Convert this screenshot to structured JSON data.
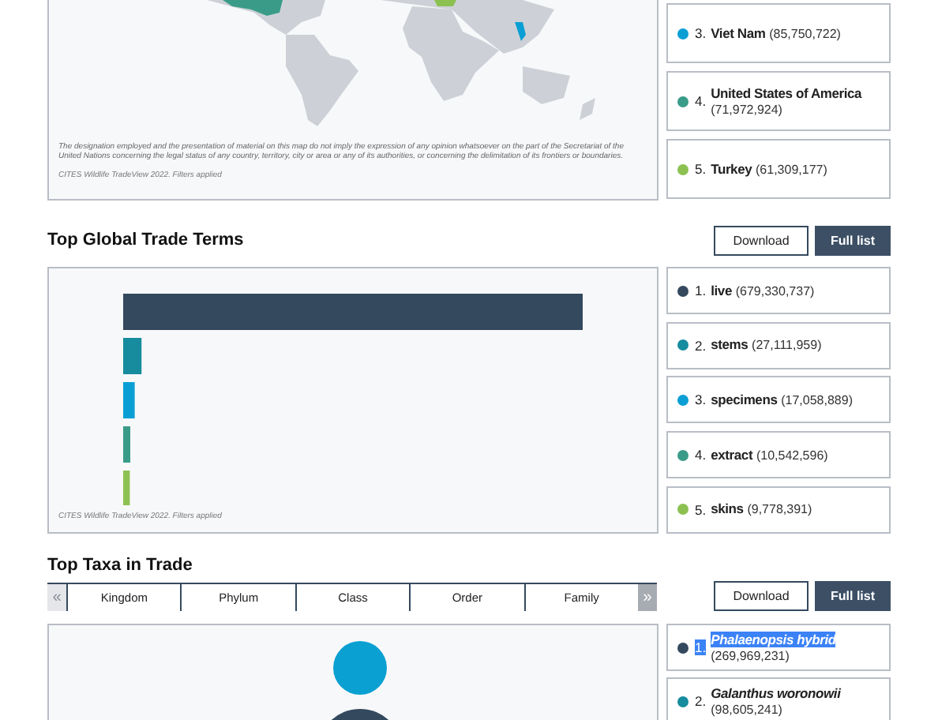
{
  "top_countries": {
    "map_disclaimer": "The designation employed and the presentation of material on this map do not imply the expression of any opinion whatsoever on the part of the Secretariat of the United Nations concerning the legal status of any country, territory, city or area or any of its authorities, or concerning the delimitation of its frontiers or boundaries.",
    "credit": "CITES Wildlife TradeView 2022. Filters applied",
    "items": [
      {
        "rank": "3.",
        "name": "Viet Nam",
        "count": "(85,750,722)",
        "color": "#0a9fd4"
      },
      {
        "rank": "4.",
        "name": "United States of America",
        "count": "(71,972,924)",
        "color": "#3a9c88"
      },
      {
        "rank": "5.",
        "name": "Turkey",
        "count": "(61,309,177)",
        "color": "#8cc152"
      }
    ]
  },
  "trade_terms": {
    "title": "Top Global Trade Terms",
    "buttons": [
      "Download",
      "Full list"
    ],
    "credit": "CITES Wildlife TradeView 2022. Filters applied",
    "items": [
      {
        "rank": "1.",
        "name": "live",
        "count": "(679,330,737)",
        "color": "#34495e"
      },
      {
        "rank": "2.",
        "name": "stems",
        "count": "(27,111,959)",
        "color": "#168c9e"
      },
      {
        "rank": "3.",
        "name": "specimens",
        "count": "(17,058,889)",
        "color": "#0a9fd4"
      },
      {
        "rank": "4.",
        "name": "extract",
        "count": "(10,542,596)",
        "color": "#3a9c88"
      },
      {
        "rank": "5.",
        "name": "skins",
        "count": "(9,778,391)",
        "color": "#8cc152"
      }
    ]
  },
  "top_taxa": {
    "title": "Top Taxa in Trade",
    "buttons": [
      "Download",
      "Full list"
    ],
    "scroll_buttons": [
      {
        "label": "«",
        "disabled": true
      },
      {
        "label": "»",
        "disabled": false
      }
    ],
    "tabs": [
      {
        "label": "Kingdom",
        "selected": false
      },
      {
        "label": "Phylum",
        "selected": false
      },
      {
        "label": "Class",
        "selected": false
      },
      {
        "label": "Order",
        "selected": false
      },
      {
        "label": "Family",
        "selected": false
      }
    ],
    "items": [
      {
        "rank": "1.",
        "name": "Phalaenopsis hybrid",
        "count": "(269,969,231)",
        "color": "#34495e",
        "highlighted": true
      },
      {
        "rank": "2.",
        "name": "Galanthus woronowii",
        "count": "(98,605,241)",
        "color": "#168c9e",
        "highlighted": false
      }
    ]
  }
}
